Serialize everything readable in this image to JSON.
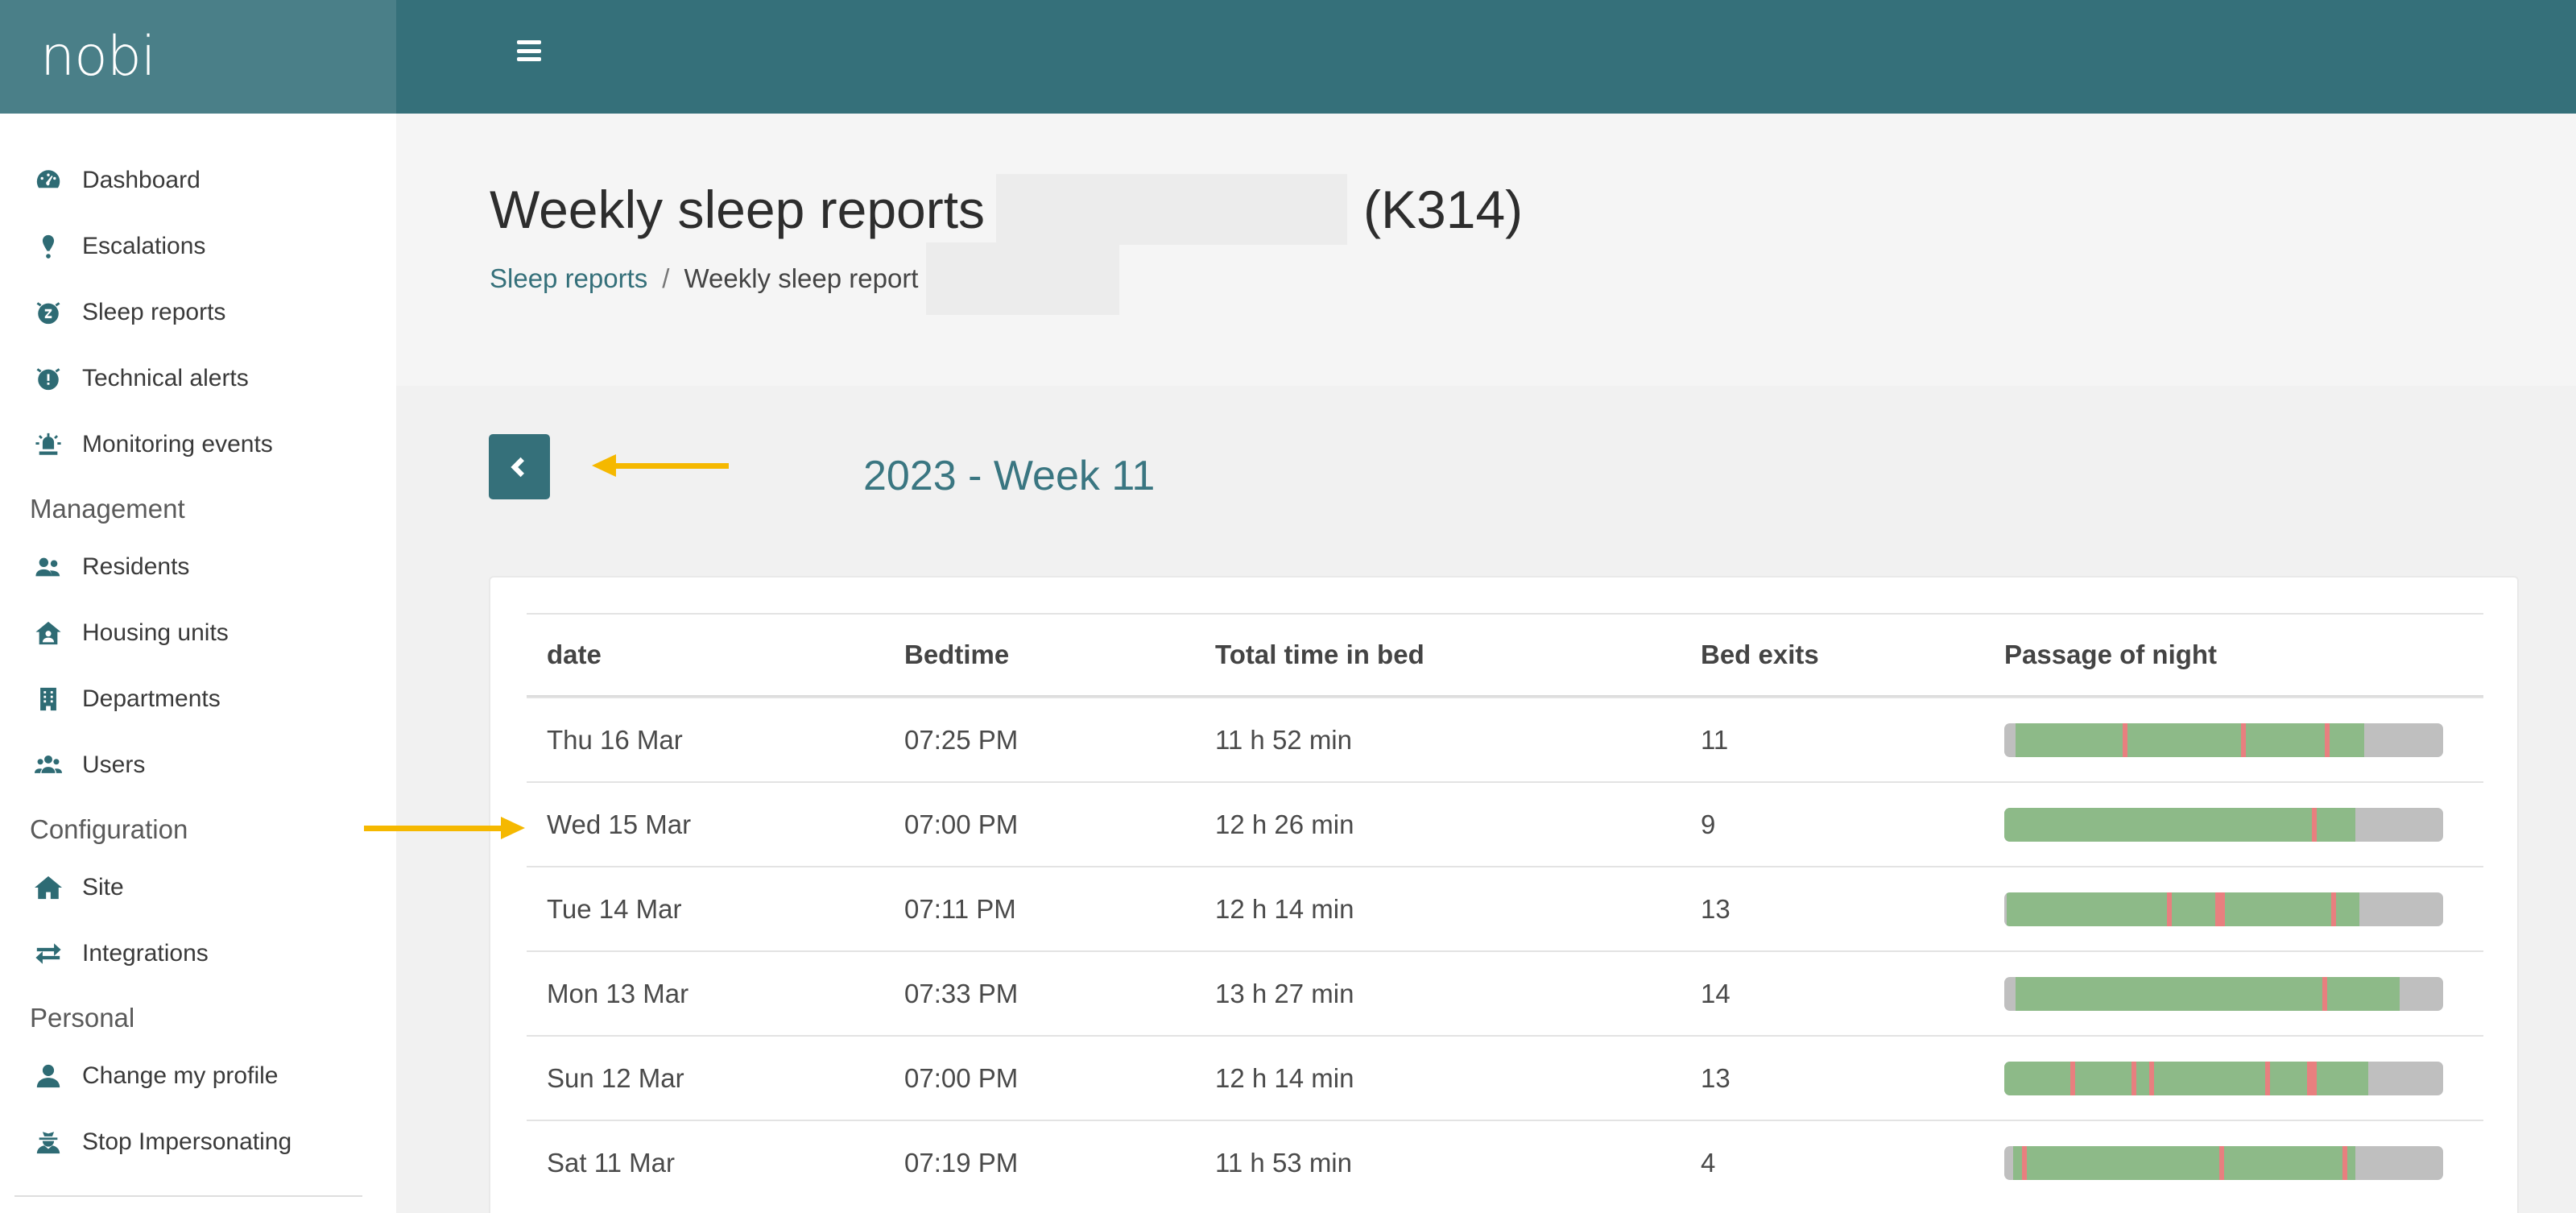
{
  "brand": "nobi",
  "sidebar": {
    "items": [
      {
        "label": "Dashboard",
        "icon": "gauge-icon"
      },
      {
        "label": "Escalations",
        "icon": "exclamation-icon"
      },
      {
        "label": "Sleep reports",
        "icon": "sleep-clock-icon"
      },
      {
        "label": "Technical alerts",
        "icon": "alarm-clock-icon"
      },
      {
        "label": "Monitoring events",
        "icon": "siren-icon"
      }
    ],
    "sections": [
      {
        "title": "Management",
        "items": [
          {
            "label": "Residents",
            "icon": "users-icon"
          },
          {
            "label": "Housing units",
            "icon": "house-user-icon"
          },
          {
            "label": "Departments",
            "icon": "building-icon"
          },
          {
            "label": "Users",
            "icon": "users-group-icon"
          }
        ]
      },
      {
        "title": "Configuration",
        "items": [
          {
            "label": "Site",
            "icon": "home-icon"
          },
          {
            "label": "Integrations",
            "icon": "exchange-arrows-icon"
          }
        ]
      },
      {
        "title": "Personal",
        "items": [
          {
            "label": "Change my profile",
            "icon": "user-icon"
          },
          {
            "label": "Stop Impersonating",
            "icon": "user-secret-icon"
          }
        ]
      }
    ]
  },
  "header": {
    "title": "Weekly sleep reports",
    "room_code": "(K314)",
    "breadcrumb": {
      "link": "Sleep reports",
      "separator": "/",
      "current": "Weekly sleep report"
    }
  },
  "week": {
    "title": "2023 - Week 11",
    "back_icon": "chevron-left-icon"
  },
  "table": {
    "columns": [
      "date",
      "Bedtime",
      "Total time in bed",
      "Bed exits",
      "Passage of night"
    ],
    "rows": [
      {
        "date": "Thu 16 Mar",
        "bedtime": "07:25 PM",
        "total": "11 h 52 min",
        "exits": "11",
        "night": {
          "in_bed": [
            0.025,
            0.82
          ],
          "exits": [
            0.27,
            0.54,
            0.73
          ]
        }
      },
      {
        "date": "Wed 15 Mar",
        "bedtime": "07:00 PM",
        "total": "12 h 26 min",
        "exits": "9",
        "night": {
          "in_bed": [
            0.0,
            0.8
          ],
          "exits": [
            0.7
          ]
        }
      },
      {
        "date": "Tue 14 Mar",
        "bedtime": "07:11 PM",
        "total": "12 h 14 min",
        "exits": "13",
        "night": {
          "in_bed": [
            0.005,
            0.81
          ],
          "exits": [
            0.37,
            0.48,
            0.745
          ]
        }
      },
      {
        "date": "Mon 13 Mar",
        "bedtime": "07:33 PM",
        "total": "13 h 27 min",
        "exits": "14",
        "night": {
          "in_bed": [
            0.025,
            0.9
          ],
          "exits": [
            0.725
          ]
        }
      },
      {
        "date": "Sun 12 Mar",
        "bedtime": "07:00 PM",
        "total": "12 h 14 min",
        "exits": "13",
        "night": {
          "in_bed": [
            0.0,
            0.83
          ],
          "exits": [
            0.15,
            0.29,
            0.33,
            0.595,
            0.69
          ]
        }
      },
      {
        "date": "Sat 11 Mar",
        "bedtime": "07:19 PM",
        "total": "11 h 53 min",
        "exits": "4",
        "night": {
          "in_bed": [
            0.02,
            0.8
          ],
          "exits": [
            0.04,
            0.49,
            0.77
          ]
        }
      }
    ]
  },
  "colors": {
    "topbar": "#35707a",
    "brand_bg": "#4a7f88",
    "accent": "#35707a",
    "bar_in_bed": "#8dba88",
    "bar_out_of_bed": "#bfbfbf",
    "bar_exit": "#e87f7f",
    "annotation_arrow": "#f5b800"
  }
}
